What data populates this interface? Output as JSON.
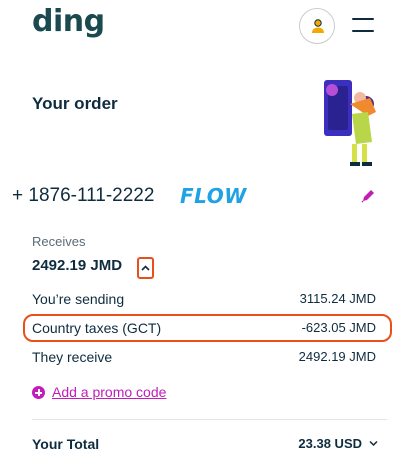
{
  "header": {
    "logo_text": "ding",
    "account_icon": "user-icon",
    "menu_icon": "hamburger-icon"
  },
  "order": {
    "title": "Your order"
  },
  "recipient": {
    "phone": "+ 1876-111-2222",
    "operator": "FLOW",
    "edit_icon": "pencil-icon"
  },
  "receives": {
    "label": "Receives",
    "amount": "2492.19 JMD",
    "toggle_icon": "chevron-up-icon"
  },
  "breakdown": [
    {
      "label": "You’re sending",
      "value": "3115.24 JMD"
    },
    {
      "label": "Country taxes (GCT)",
      "value": "-623.05 JMD"
    },
    {
      "label": "They receive",
      "value": "2492.19 JMD"
    }
  ],
  "promo": {
    "label": "Add a promo code",
    "icon": "plus-circle-icon"
  },
  "total": {
    "label": "Your Total",
    "value": "23.38 USD",
    "toggle_icon": "chevron-down-icon"
  },
  "colors": {
    "brand": "#1a4a4f",
    "text": "#0f2c3f",
    "accent_magenta": "#c21cb9",
    "highlight_orange": "#e94e1b",
    "operator_blue": "#1fa3e4"
  }
}
